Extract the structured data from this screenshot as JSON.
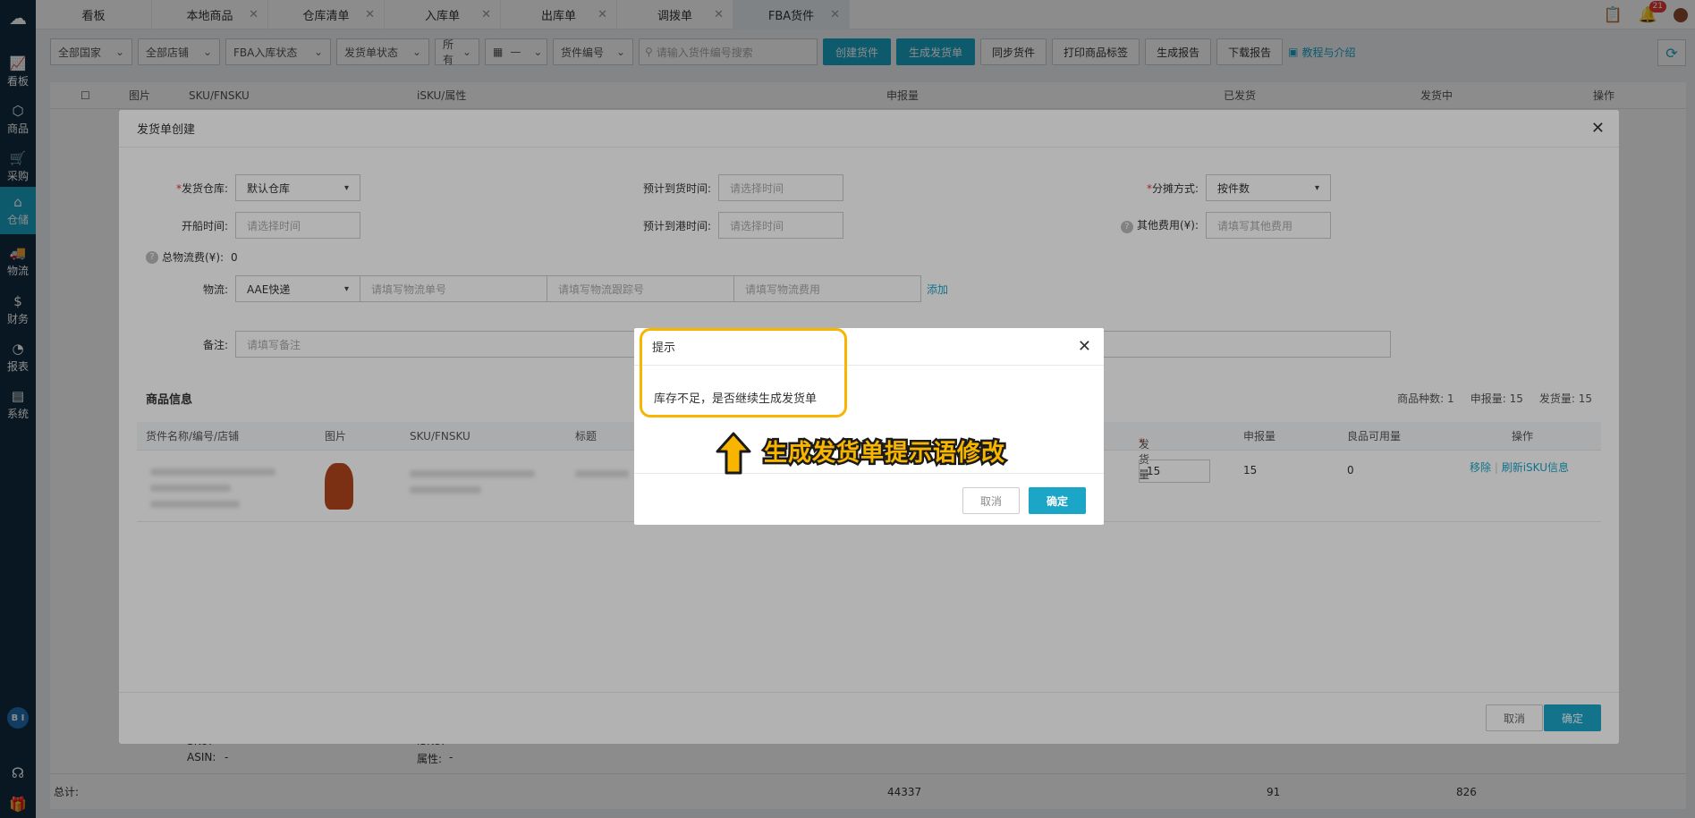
{
  "sidebar": {
    "logo": "logo",
    "items": [
      {
        "label": "看板",
        "icon": "chart-icon"
      },
      {
        "label": "商品",
        "icon": "box-icon"
      },
      {
        "label": "采购",
        "icon": "cart-icon"
      },
      {
        "label": "仓储",
        "icon": "warehouse-icon"
      },
      {
        "label": "物流",
        "icon": "truck-icon"
      },
      {
        "label": "财务",
        "icon": "money-icon"
      },
      {
        "label": "报表",
        "icon": "pie-icon"
      },
      {
        "label": "系统",
        "icon": "settings-icon"
      }
    ],
    "active_index": 3,
    "avatar": "B I"
  },
  "tabs": [
    {
      "label": "看板"
    },
    {
      "label": "本地商品"
    },
    {
      "label": "仓库清单"
    },
    {
      "label": "入库单"
    },
    {
      "label": "出库单"
    },
    {
      "label": "调拨单"
    },
    {
      "label": "FBA货件"
    }
  ],
  "top_right": {
    "notification_count": "21"
  },
  "toolbar": {
    "country": "全部国家",
    "store": "全部店铺",
    "fba_status": "FBA入库状态",
    "ship_status": "发货单状态",
    "all": "所有",
    "date_sep": "—",
    "shipment_no": "货件编号",
    "search_placeholder": "请输入货件编号搜索",
    "create_shipment": "创建货件",
    "generate_shipping": "生成发货单",
    "sync_shipment": "同步货件",
    "print_labels": "打印商品标签",
    "generate_report": "生成报告",
    "download_report": "下载报告",
    "tutorial": "教程与介绍"
  },
  "bg_table": {
    "headers": {
      "image": "图片",
      "sku": "SKU/FNSKU",
      "isku": "iSKU/属性",
      "declared": "申报量",
      "shipped": "已发货",
      "in_transit": "发货中",
      "ops": "操作"
    },
    "row": {
      "sku_label": "SKU:",
      "asin_label": "ASIN:",
      "asin_value": "-",
      "isku_label": "iSKU:",
      "isku_value": "-",
      "attr_label": "属性:",
      "attr_value": "-"
    },
    "footer": {
      "total_label": "总计:",
      "declared_total": "44337",
      "shipped_total": "91",
      "in_transit_total": "826"
    }
  },
  "modal": {
    "title": "发货单创建",
    "warehouse_label": "发货仓库:",
    "warehouse_value": "默认仓库",
    "eta_label": "预计到货时间:",
    "eta_placeholder": "请选择时间",
    "split_label": "分摊方式:",
    "split_value": "按件数",
    "sail_label": "开船时间:",
    "sail_placeholder": "请选择时间",
    "port_label": "预计到港时间:",
    "port_placeholder": "请选择时间",
    "other_fee_label": "其他费用(¥):",
    "other_fee_placeholder": "请填写其他费用",
    "logistics_fee_label": "总物流费(¥):",
    "logistics_fee_value": "0",
    "logistics_label": "物流:",
    "logistics_value": "AAE快递",
    "tracking_placeholder": "请填写物流单号",
    "tracking_no_placeholder": "请填写物流跟踪号",
    "logistics_cost_placeholder": "请填写物流费用",
    "add_link": "添加",
    "remark_label": "备注:",
    "remark_placeholder": "请填写备注",
    "section_title": "商品信息",
    "stats": {
      "kinds_label": "商品种数:",
      "kinds": "1",
      "declared_label": "申报量:",
      "declared": "15",
      "ship_label": "发货量:",
      "ship": "15"
    },
    "grid_headers": {
      "name": "货件名称/编号/店铺",
      "image": "图片",
      "sku": "SKU/FNSKU",
      "title": "标题",
      "ship_qty": "发货量",
      "declared": "申报量",
      "available": "良品可用量",
      "ops": "操作"
    },
    "grid_row": {
      "ship_qty": "15",
      "declared": "15",
      "available": "0",
      "remove": "移除",
      "refresh": "刷新iSKU信息"
    },
    "cancel": "取消",
    "confirm": "确定"
  },
  "dialog": {
    "title": "提示",
    "message": "库存不足，是否继续生成发货单",
    "cancel": "取消",
    "confirm": "确定"
  },
  "annotation": {
    "text": "生成发货单提示语修改",
    "color": "#f7b500"
  },
  "colors": {
    "accent": "#1ba5c7",
    "sidebar": "#0f2a3d"
  }
}
